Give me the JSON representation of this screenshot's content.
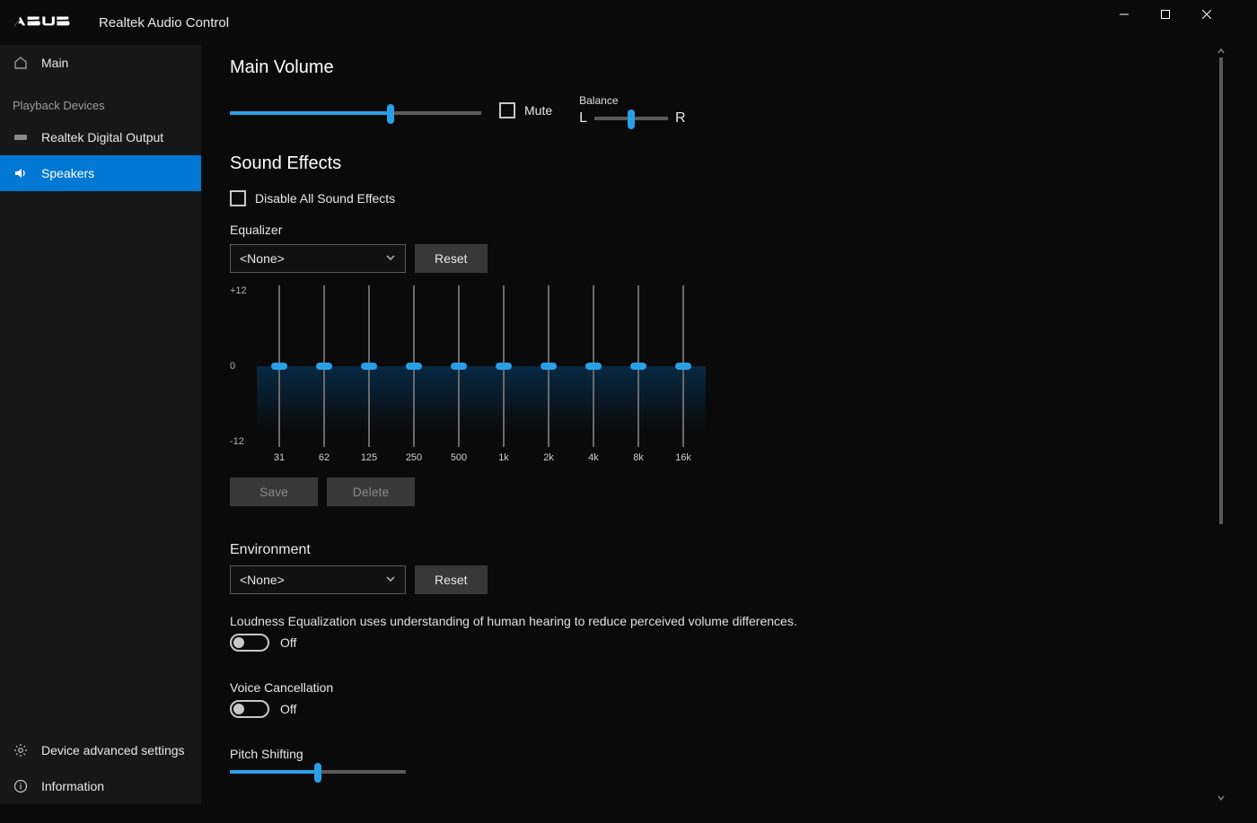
{
  "app": {
    "title": "Realtek Audio Control"
  },
  "sidebar": {
    "main": "Main",
    "section_playback": "Playback Devices",
    "items": [
      {
        "label": "Realtek Digital Output"
      },
      {
        "label": "Speakers"
      }
    ],
    "advanced": "Device advanced settings",
    "info": "Information"
  },
  "volume": {
    "title": "Main Volume",
    "percent": 64,
    "mute_label": "Mute",
    "balance_label": "Balance",
    "balance_left": "L",
    "balance_right": "R",
    "balance_percent": 50
  },
  "effects": {
    "title": "Sound Effects",
    "disable_label": "Disable All Sound Effects",
    "equalizer_label": "Equalizer",
    "preset": "<None>",
    "reset_label": "Reset",
    "save_label": "Save",
    "delete_label": "Delete",
    "scale_top": "+12",
    "scale_mid": "0",
    "scale_bot": "-12",
    "bands": [
      "31",
      "62",
      "125",
      "250",
      "500",
      "1k",
      "2k",
      "4k",
      "8k",
      "16k"
    ]
  },
  "environment": {
    "label": "Environment",
    "preset": "<None>",
    "reset_label": "Reset"
  },
  "loudness": {
    "desc": "Loudness Equalization uses understanding of human hearing to reduce perceived volume differences.",
    "state": "Off"
  },
  "voice": {
    "label": "Voice Cancellation",
    "state": "Off"
  },
  "pitch": {
    "label": "Pitch Shifting",
    "percent": 50
  }
}
